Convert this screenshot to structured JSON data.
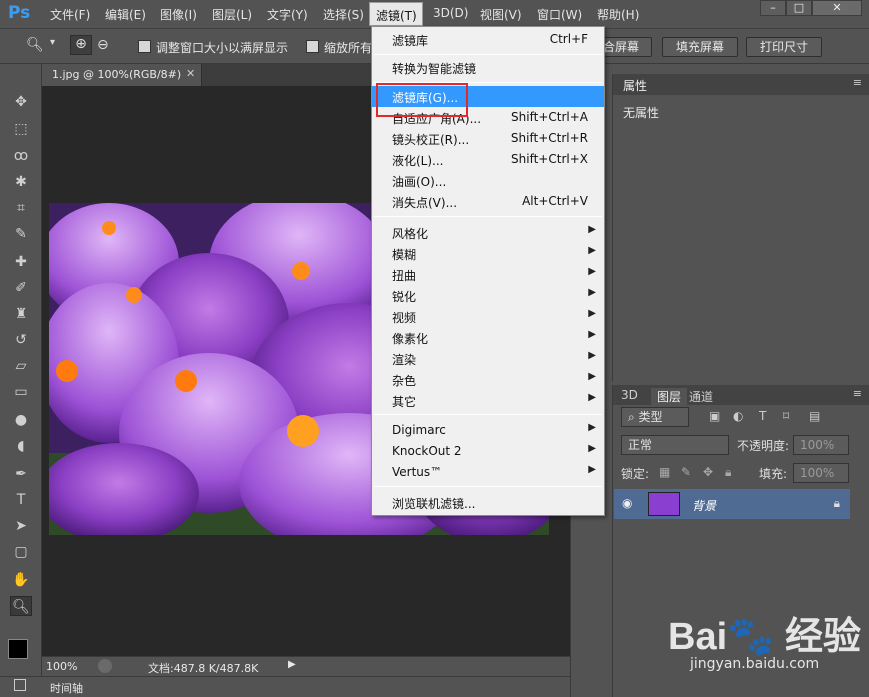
{
  "app": {
    "logo": "Ps"
  },
  "menubar": {
    "items": [
      "文件(F)",
      "编辑(E)",
      "图像(I)",
      "图层(L)",
      "文字(Y)",
      "选择(S)",
      "滤镜(T)",
      "3D(D)",
      "视图(V)",
      "窗口(W)",
      "帮助(H)"
    ]
  },
  "options": {
    "check1_label": "调整窗口大小以满屏显示",
    "check2_label": "缩放所有",
    "btn_fill_screen_partial": "合屏幕",
    "btn_fill_screen": "填充屏幕",
    "btn_print_size": "打印尺寸"
  },
  "document": {
    "tab_title": "1.jpg @ 100%(RGB/8#)",
    "zoom": "100%",
    "doc_info": "文档:487.8 K/487.8K"
  },
  "timeline": {
    "label": "时间轴"
  },
  "filter_menu": {
    "last_filter": {
      "label": "滤镜库",
      "shortcut": "Ctrl+F"
    },
    "smart": "转换为智能滤镜",
    "group1": [
      {
        "label": "滤镜库(G)...",
        "shortcut": ""
      },
      {
        "label": "自适应广角(A)...",
        "shortcut": "Shift+Ctrl+A"
      },
      {
        "label": "镜头校正(R)...",
        "shortcut": "Shift+Ctrl+R"
      },
      {
        "label": "液化(L)...",
        "shortcut": "Shift+Ctrl+X"
      },
      {
        "label": "油画(O)...",
        "shortcut": ""
      },
      {
        "label": "消失点(V)...",
        "shortcut": "Alt+Ctrl+V"
      }
    ],
    "group2": [
      "风格化",
      "模糊",
      "扭曲",
      "锐化",
      "视频",
      "像素化",
      "渲染",
      "杂色",
      "其它"
    ],
    "group3": [
      "Digimarc",
      "KnockOut 2",
      "Vertus™"
    ],
    "browse": "浏览联机滤镜..."
  },
  "properties": {
    "tab": "属性",
    "content": "无属性"
  },
  "layers": {
    "tabs": [
      "3D",
      "图层",
      "通道"
    ],
    "filter_kind": "类型",
    "blend_mode": "正常",
    "opacity_label": "不透明度:",
    "opacity_value": "100%",
    "lock_label": "锁定:",
    "fill_label": "填充:",
    "fill_value": "100%",
    "layer_name": "背景"
  },
  "watermark": {
    "logo": "Baidu经验",
    "url": "jingyan.baidu.com"
  },
  "colors": {
    "highlight": "#3399ff",
    "red_box": "#e12b2b",
    "layer_selected": "#4f6b94"
  }
}
